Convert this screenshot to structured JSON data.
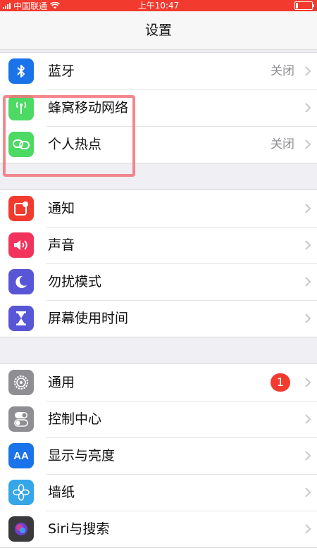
{
  "status_bar": {
    "carrier": "中国联通",
    "time": "上午10:47",
    "battery_level": 0.15,
    "color": "#f23a2f"
  },
  "nav": {
    "title": "设置"
  },
  "groups": [
    [
      {
        "label": "蓝牙",
        "value": "关闭",
        "icon": "bluetooth-icon",
        "color": "#1a73e8"
      },
      {
        "label": "蜂窝移动网络",
        "value": "",
        "icon": "cellular-antenna-icon",
        "color": "#4cd964"
      },
      {
        "label": "个人热点",
        "value": "关闭",
        "icon": "personal-hotspot-icon",
        "color": "#4cd964"
      }
    ],
    [
      {
        "label": "通知",
        "icon": "notifications-icon",
        "color": "#f23a2f"
      },
      {
        "label": "声音",
        "icon": "speaker-icon",
        "color": "#f2335c"
      },
      {
        "label": "勿扰模式",
        "icon": "moon-icon",
        "color": "#5856d6"
      },
      {
        "label": "屏幕使用时间",
        "icon": "hourglass-icon",
        "color": "#5856d6"
      }
    ],
    [
      {
        "label": "通用",
        "badge": "1",
        "icon": "gear-icon",
        "color": "#8e8e93"
      },
      {
        "label": "控制中心",
        "icon": "toggles-icon",
        "color": "#8e8e93"
      },
      {
        "label": "显示与亮度",
        "icon": "text-size-icon",
        "icon_text": "AA",
        "color": "#1a73e8"
      },
      {
        "label": "墙纸",
        "icon": "wallpaper-flower-icon",
        "color": "#35a6e8"
      },
      {
        "label": "Siri与搜索",
        "icon": "siri-icon",
        "color": "#3a3a3c"
      }
    ]
  ]
}
